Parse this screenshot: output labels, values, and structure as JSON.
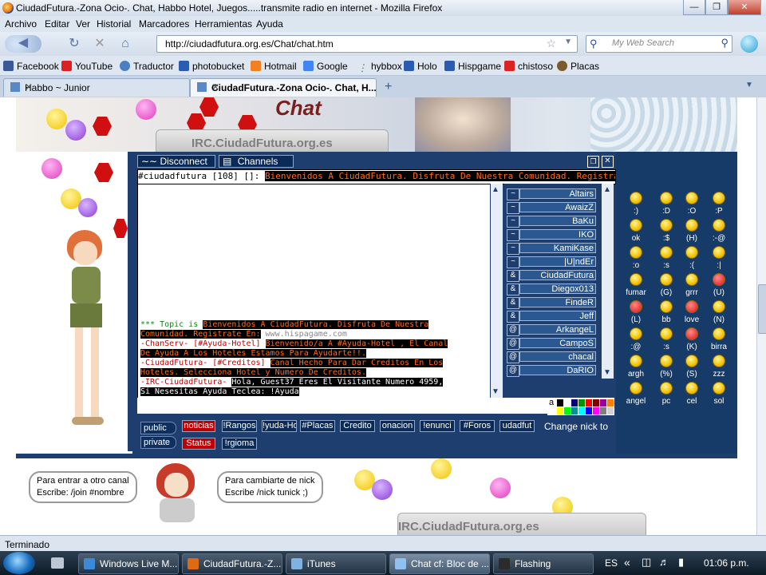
{
  "window": {
    "title": "CiudadFutura.-Zona Ocio-. Chat, Habbo Hotel, Juegos.....transmite radio en internet - Mozilla Firefox"
  },
  "menu": [
    "Archivo",
    "Editar",
    "Ver",
    "Historial",
    "Marcadores",
    "Herramientas",
    "Ayuda"
  ],
  "nav": {
    "url": "http://ciudadfutura.org.es/Chat/chat.htm",
    "search_placeholder": "My Web Search"
  },
  "bookmarks": [
    {
      "label": "Facebook",
      "color": "#3b5998"
    },
    {
      "label": "YouTube",
      "color": "#d22"
    },
    {
      "label": "Traductor",
      "color": "#4a7fc2"
    },
    {
      "label": "photobucket",
      "color": "#2a5db0"
    },
    {
      "label": "Hotmail",
      "color": "#f08020"
    },
    {
      "label": "Google",
      "color": "#4285f4"
    },
    {
      "label": "hybbox",
      "color": "#666"
    },
    {
      "label": "Holo",
      "color": "#2a5db0"
    },
    {
      "label": "Hispgame",
      "color": "#2a5db0"
    },
    {
      "label": "chistoso",
      "color": "#d22"
    },
    {
      "label": "Placas",
      "color": "#7b5b2b"
    }
  ],
  "tabs": [
    {
      "label": "Habbo ~ Junior"
    },
    {
      "label": "CiudadFutura.-Zona Ocio-. Chat, H..."
    }
  ],
  "page": {
    "chat_word": "Chat",
    "banner_label": "IRC.CiudadFutura.org.es",
    "bottom_label": "IRC.CiudadFutura.org.es",
    "bubble_left": [
      "Para entrar a otro canal",
      "Escribe: /join #nombre"
    ],
    "bubble_right": [
      "Para cambiarte de nick",
      "Escribe  /nick tunick ;)"
    ]
  },
  "applet": {
    "disconnect": "Disconnect",
    "channels": "Channels",
    "channel_prefix": "#ciudadfutura [108] []:",
    "channel_topic": "Bienvenidos A CiudadFutura. Disfruta De Nuestra Comunidad. Registra",
    "chat_lines": [
      {
        "pre": "*** Topic is ",
        "hl": "Bienvenidos A CiudadFutura. Disfruta De Nuestra",
        "post": ""
      },
      {
        "pre": " ",
        "hl": "Comunidad. Registrate En:",
        "post": " www.hispagame.com"
      },
      {
        "pre": "-ChanServ- [#Ayuda-Hotel] ",
        "hl": "Bienvenido/a A #Ayuda-Hotel , El Canal",
        "post": ""
      },
      {
        "pre": " ",
        "hl": "De Ayuda A Los Hoteles Estamos Para Ayudarte!!.",
        "post": ""
      },
      {
        "pre": "-CiudadFutura- [#Creditos] ",
        "hl": "Canal Hecho Para Dar Creditos En Los",
        "post": ""
      },
      {
        "pre": " ",
        "hl": "Hoteles. Selecciona Hotel y Numero De Creditos.",
        "post": ""
      },
      {
        "pre": "-IRC-CiudadFutura- ",
        "hl": "Hola, Guest37  Eres El Visitante Numero  4959,",
        "post": ""
      },
      {
        "pre": " ",
        "hl": "Si Nesesitas Ayuda Teclea: !Ayuda",
        "post": ""
      }
    ],
    "nicks": [
      {
        "mode": "~",
        "nick": "Altairs"
      },
      {
        "mode": "~",
        "nick": "AwaizZ"
      },
      {
        "mode": "~",
        "nick": "BaKu"
      },
      {
        "mode": "~",
        "nick": "IKO"
      },
      {
        "mode": "~",
        "nick": "KamiKase"
      },
      {
        "mode": "~",
        "nick": "|U|ndEr"
      },
      {
        "mode": "&",
        "nick": "CiudadFutura"
      },
      {
        "mode": "&",
        "nick": "Diegox013"
      },
      {
        "mode": "&",
        "nick": "FindeR"
      },
      {
        "mode": "&",
        "nick": "Jeff"
      },
      {
        "mode": "@",
        "nick": "ArkangeL"
      },
      {
        "mode": "@",
        "nick": "CampoS"
      },
      {
        "mode": "@",
        "nick": "chacal"
      },
      {
        "mode": "@",
        "nick": "DaRIO"
      }
    ],
    "public_label": "public",
    "private_label": "private",
    "public_buttons": [
      "noticias",
      "!Rangos",
      "!yuda-Ho",
      "#Placas",
      "Credito",
      "onacion",
      "!enunci",
      "#Foros",
      "udadfut"
    ],
    "private_buttons": [
      "Status",
      "!rgioma"
    ],
    "change_nick": "Change nick to",
    "palette_label": "a"
  },
  "emoticons": [
    [
      ":)",
      ":D",
      ":O",
      ":P"
    ],
    [
      "ok",
      ":$",
      "(H)",
      ":-@"
    ],
    [
      ":o",
      ":s",
      ":(",
      ":|"
    ],
    [
      "fumar",
      "(G)",
      "grrr",
      "(U)"
    ],
    [
      "(L)",
      "bb",
      "love",
      "(N)"
    ],
    [
      ":@",
      ":s",
      "(K)",
      "birra"
    ],
    [
      "argh",
      "(%)",
      "(S)",
      "zzz"
    ],
    [
      "angel",
      "pc",
      "cel",
      "sol"
    ]
  ],
  "status": "Terminado",
  "taskbar": {
    "items": [
      {
        "label": "Windows Live M...",
        "color": "#3a8ad8"
      },
      {
        "label": "CiudadFutura.-Z...",
        "color": "#e06a12"
      },
      {
        "label": "iTunes",
        "color": "#7fb2e0"
      },
      {
        "label": "Chat cf: Bloc de ...",
        "color": "#8fc0ee"
      },
      {
        "label": "Flashing",
        "color": "#2b2b2b"
      }
    ],
    "lang": "ES",
    "clock": "01:06 p.m."
  }
}
